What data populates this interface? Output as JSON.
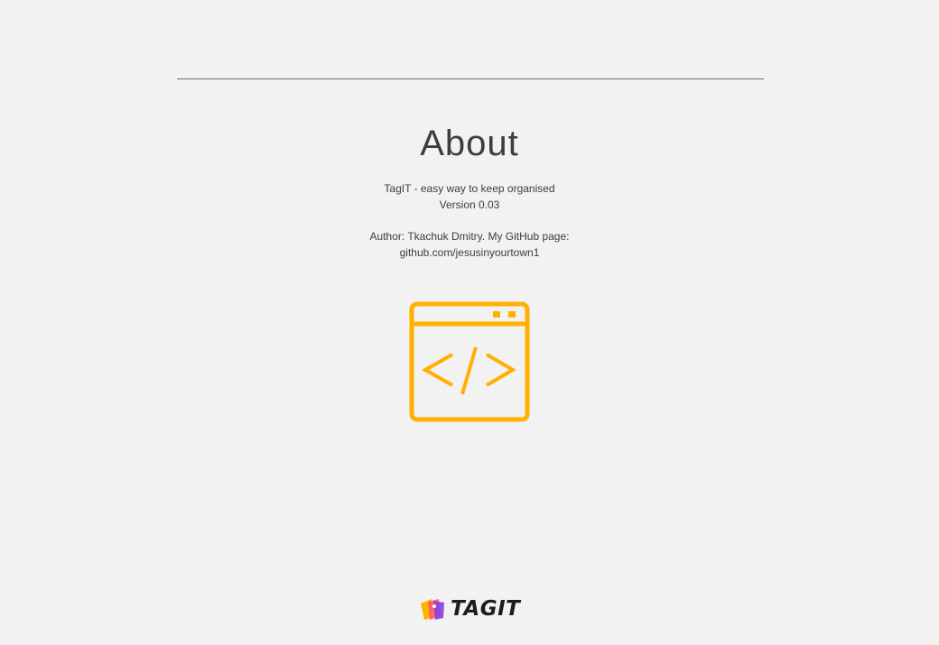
{
  "page": {
    "title": "About"
  },
  "about": {
    "tagline": "TagIT - easy way to keep organised",
    "version": "Version 0.03",
    "author_line": "Author: Tkachuk Dmitry.  My GitHub page:",
    "github_link": "github.com/jesusinyourtown1"
  },
  "icons": {
    "main_icon": "code-window-icon",
    "logo_icon": "tagit-logo-icon"
  },
  "footer": {
    "logo_text": "TAGIT"
  },
  "colors": {
    "background": "#f2f2f2",
    "accent": "#ffb000",
    "text": "#3d3d3d"
  }
}
